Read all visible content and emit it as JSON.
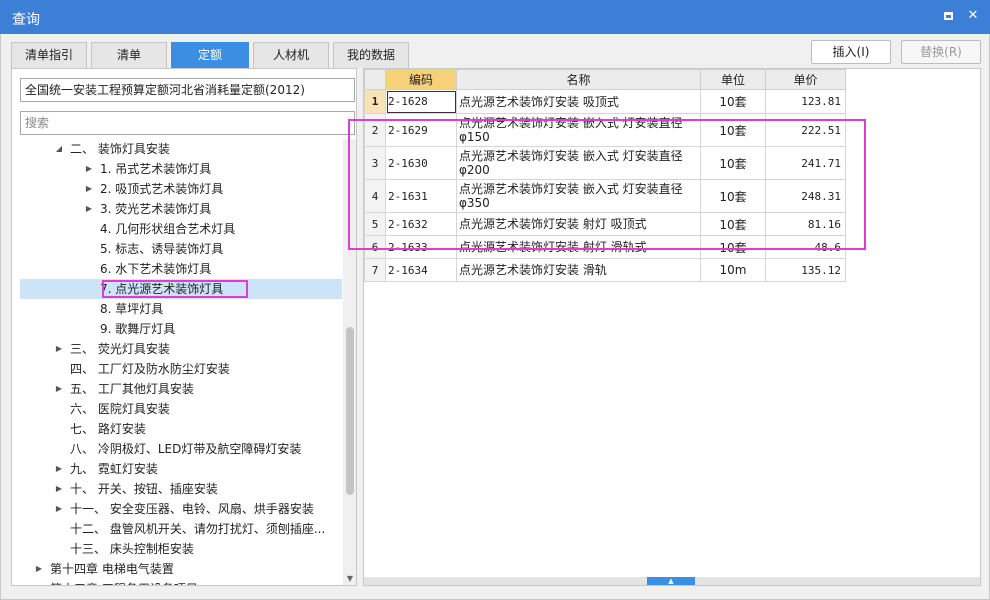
{
  "window": {
    "title": "查询"
  },
  "tabs": [
    "清单指引",
    "清单",
    "定额",
    "人材机",
    "我的数据"
  ],
  "buttons": {
    "insert": "插入(I)",
    "replace": "替换(R)"
  },
  "left": {
    "quota_library": "全国统一安装工程预算定额河北省消耗量定额(2012)",
    "search_placeholder": "搜索",
    "tree": [
      {
        "label": "二、 装饰灯具安装",
        "arrow": "▲",
        "indent": 1
      },
      {
        "label": "1. 吊式艺术装饰灯具",
        "arrow": "▶",
        "indent": 2
      },
      {
        "label": "2. 吸顶式艺术装饰灯具",
        "arrow": "▶",
        "indent": 2
      },
      {
        "label": "3. 荧光艺术装饰灯具",
        "arrow": "▶",
        "indent": 2
      },
      {
        "label": "4. 几何形状组合艺术灯具",
        "arrow": "",
        "indent": 2
      },
      {
        "label": "5. 标志、诱导装饰灯具",
        "arrow": "",
        "indent": 2
      },
      {
        "label": "6. 水下艺术装饰灯具",
        "arrow": "",
        "indent": 2
      },
      {
        "label": "7. 点光源艺术装饰灯具",
        "arrow": "",
        "indent": 2,
        "selected": true
      },
      {
        "label": "8. 草坪灯具",
        "arrow": "",
        "indent": 2
      },
      {
        "label": "9. 歌舞厅灯具",
        "arrow": "",
        "indent": 2
      },
      {
        "label": "三、 荧光灯具安装",
        "arrow": "▶",
        "indent": 1
      },
      {
        "label": "四、 工厂灯及防水防尘灯安装",
        "arrow": "",
        "indent": 1
      },
      {
        "label": "五、 工厂其他灯具安装",
        "arrow": "▶",
        "indent": 1
      },
      {
        "label": "六、 医院灯具安装",
        "arrow": "",
        "indent": 1
      },
      {
        "label": "七、 路灯安装",
        "arrow": "",
        "indent": 1
      },
      {
        "label": "八、 冷阴极灯、LED灯带及航空障碍灯安装",
        "arrow": "",
        "indent": 1
      },
      {
        "label": "九、 霓虹灯安装",
        "arrow": "▶",
        "indent": 1
      },
      {
        "label": "十、 开关、按钮、插座安装",
        "arrow": "▶",
        "indent": 1
      },
      {
        "label": "十一、 安全变压器、电铃、风扇、烘手器安装",
        "arrow": "▶",
        "indent": 1
      },
      {
        "label": "十二、 盘管风机开关、请勿打扰灯、须刨插座...",
        "arrow": "",
        "indent": 1
      },
      {
        "label": "十三、 床头控制柜安装",
        "arrow": "",
        "indent": 1
      },
      {
        "label": "第十四章 电梯电气装置",
        "arrow": "▶",
        "indent": 0
      },
      {
        "label": "第十五章 工程备用设备项目",
        "arrow": "",
        "indent": 0
      }
    ]
  },
  "grid": {
    "columns": [
      "编码",
      "名称",
      "单位",
      "单价"
    ],
    "rows": [
      {
        "num": "1",
        "code": "2-1628",
        "name": "点光源艺术装饰灯安装 吸顶式",
        "unit": "10套",
        "price": "123.81"
      },
      {
        "num": "2",
        "code": "2-1629",
        "name": "点光源艺术装饰灯安装 嵌入式 灯安装直径φ150",
        "unit": "10套",
        "price": "222.51"
      },
      {
        "num": "3",
        "code": "2-1630",
        "name": "点光源艺术装饰灯安装 嵌入式 灯安装直径φ200",
        "unit": "10套",
        "price": "241.71"
      },
      {
        "num": "4",
        "code": "2-1631",
        "name": "点光源艺术装饰灯安装 嵌入式 灯安装直径φ350",
        "unit": "10套",
        "price": "248.31"
      },
      {
        "num": "5",
        "code": "2-1632",
        "name": "点光源艺术装饰灯安装 射灯 吸顶式",
        "unit": "10套",
        "price": "81.16"
      },
      {
        "num": "6",
        "code": "2-1633",
        "name": "点光源艺术装饰灯安装 射灯 滑轨式",
        "unit": "10套",
        "price": "48.6"
      },
      {
        "num": "7",
        "code": "2-1634",
        "name": "点光源艺术装饰灯安装 滑轨",
        "unit": "10m",
        "price": "135.12"
      }
    ]
  },
  "colors": {
    "titlebar": "#3b7fd6",
    "active_tab": "#3b8ee2",
    "highlight": "#e23ad4",
    "selected_row": "#cde3f7"
  },
  "icons": {
    "maximize": "maximize-icon",
    "close": "close-icon"
  }
}
